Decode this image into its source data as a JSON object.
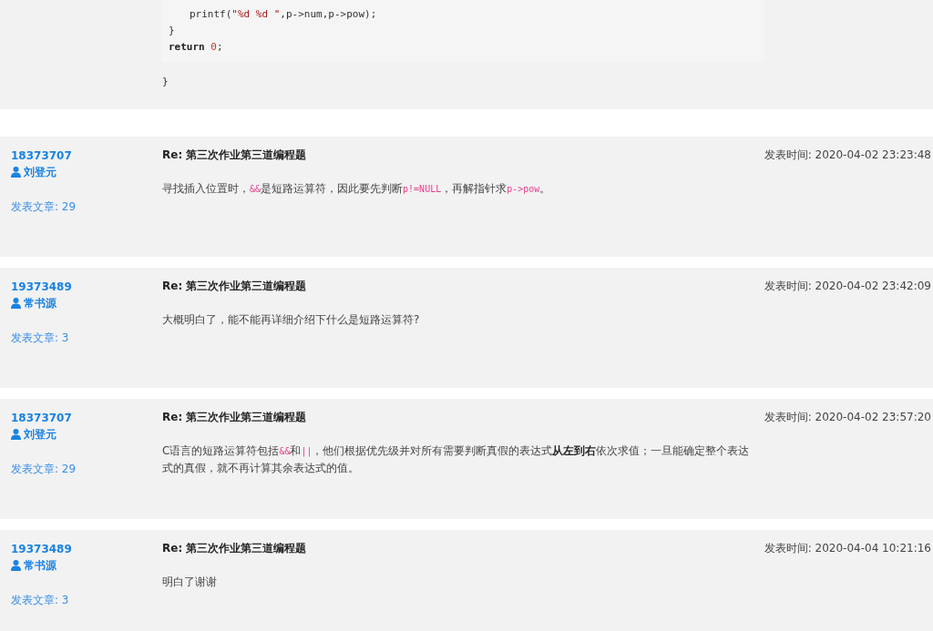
{
  "code_block": {
    "lines": [
      {
        "indent": true,
        "segments": [
          {
            "kind": "plain",
            "text": "printf("
          },
          {
            "kind": "string",
            "text": "\"%d %d \""
          },
          {
            "kind": "plain",
            "text": ",p->num,p->pow);"
          }
        ]
      },
      {
        "indent": false,
        "segments": [
          {
            "kind": "plain",
            "text": "}"
          }
        ]
      },
      {
        "indent": false,
        "segments": [
          {
            "kind": "keyword",
            "text": "return"
          },
          {
            "kind": "number",
            "text": "0"
          },
          {
            "kind": "plain",
            "text": ";"
          }
        ]
      }
    ],
    "closing": "}"
  },
  "posts": [
    {
      "user_id": "18373707",
      "username": "刘登元",
      "post_count": "发表文章: 29",
      "title": "Re: 第三次作业第三道编程题",
      "time": "发表时间: 2020-04-02 23:23:48",
      "body": [
        {
          "kind": "text",
          "text": "寻找插入位置时，"
        },
        {
          "kind": "code",
          "text": "&&"
        },
        {
          "kind": "text",
          "text": "是短路运算符，因此要先判断"
        },
        {
          "kind": "code",
          "text": "p!=NULL"
        },
        {
          "kind": "text",
          "text": "，再解指针求"
        },
        {
          "kind": "code",
          "text": "p->pow"
        },
        {
          "kind": "text",
          "text": "。"
        }
      ]
    },
    {
      "user_id": "19373489",
      "username": "常书源",
      "post_count": "发表文章: 3",
      "title": "Re: 第三次作业第三道编程题",
      "time": "发表时间: 2020-04-02 23:42:09",
      "body": [
        {
          "kind": "text",
          "text": "大概明白了，能不能再详细介绍下什么是短路运算符?"
        }
      ]
    },
    {
      "user_id": "18373707",
      "username": "刘登元",
      "post_count": "发表文章: 29",
      "title": "Re: 第三次作业第三道编程题",
      "time": "发表时间: 2020-04-02 23:57:20",
      "body": [
        {
          "kind": "text",
          "text": "C语言的短路运算符包括"
        },
        {
          "kind": "code",
          "text": "&&"
        },
        {
          "kind": "text",
          "text": "和"
        },
        {
          "kind": "code",
          "text": "||"
        },
        {
          "kind": "text",
          "text": "，他们根据优先级并对所有需要判断真假的表达式"
        },
        {
          "kind": "bold",
          "text": "从左到右"
        },
        {
          "kind": "text",
          "text": "依次求值；一旦能确定整个表达式的真假，就不再计算其余表达式的值。"
        }
      ]
    },
    {
      "user_id": "19373489",
      "username": "常书源",
      "post_count": "发表文章: 3",
      "title": "Re: 第三次作业第三道编程题",
      "time": "发表时间: 2020-04-04 10:21:16",
      "body": [
        {
          "kind": "text",
          "text": "明白了谢谢"
        }
      ]
    }
  ]
}
